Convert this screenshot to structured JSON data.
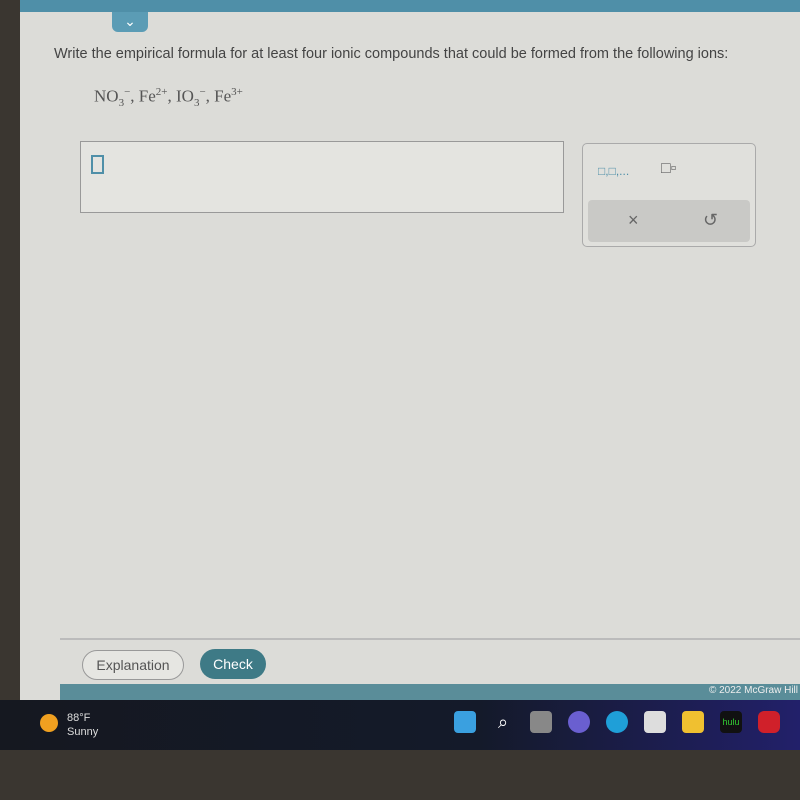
{
  "question": "Write the empirical formula for at least four ionic compounds that could be formed from the following ions:",
  "ions": [
    {
      "base": "NO",
      "sub": "3",
      "sup": "−"
    },
    {
      "base": "Fe",
      "sub": "",
      "sup": "2+"
    },
    {
      "base": "IO",
      "sub": "3",
      "sup": "−"
    },
    {
      "base": "Fe",
      "sub": "",
      "sup": "3+"
    }
  ],
  "answer": {
    "value": ""
  },
  "tools": {
    "list_label": "□,□,...",
    "subscript_label": "□▫",
    "clear_label": "×",
    "undo_label": "↺"
  },
  "buttons": {
    "explanation": "Explanation",
    "check": "Check"
  },
  "copyright": "© 2022 McGraw Hill",
  "weather": {
    "temp": "88°F",
    "condition": "Sunny"
  },
  "taskbar": {
    "icons": [
      "windows-start-icon",
      "search-icon",
      "task-view-icon",
      "teams-chat-icon",
      "edge-icon",
      "store-icon",
      "file-explorer-icon",
      "hulu-icon",
      "mcafee-icon"
    ],
    "hulu_label": "hulu"
  },
  "colors": {
    "accent": "#4f8fa8",
    "check_button": "#3e7a86"
  }
}
